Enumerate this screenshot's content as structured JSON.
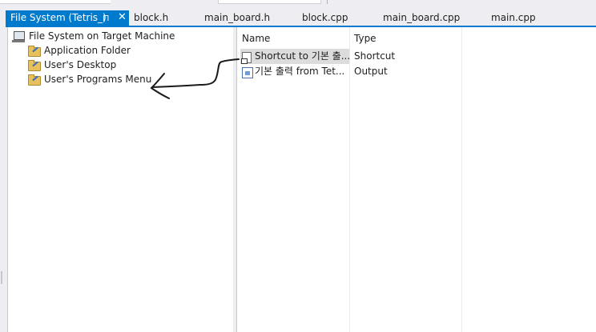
{
  "tabs": {
    "active": {
      "label": "File System (Tetris_)",
      "pin": "⊓",
      "close": "✕"
    },
    "others": [
      "block.h",
      "main_board.h",
      "block.cpp",
      "main_board.cpp",
      "main.cpp"
    ]
  },
  "tree": {
    "root": "File System on Target Machine",
    "children": [
      "Application Folder",
      "User's Desktop",
      "User's Programs Menu"
    ]
  },
  "list": {
    "columns": {
      "name": "Name",
      "type": "Type"
    },
    "rows": [
      {
        "name": "Shortcut to 기본 출...",
        "type": "Shortcut",
        "icon": "shortcut-icon"
      },
      {
        "name": "기본 출력 from Tet...",
        "type": "Output",
        "icon": "output-icon"
      }
    ]
  },
  "colors": {
    "accent": "#007acc",
    "selection": "#dcdcdc",
    "folder": "#e8c15f"
  }
}
